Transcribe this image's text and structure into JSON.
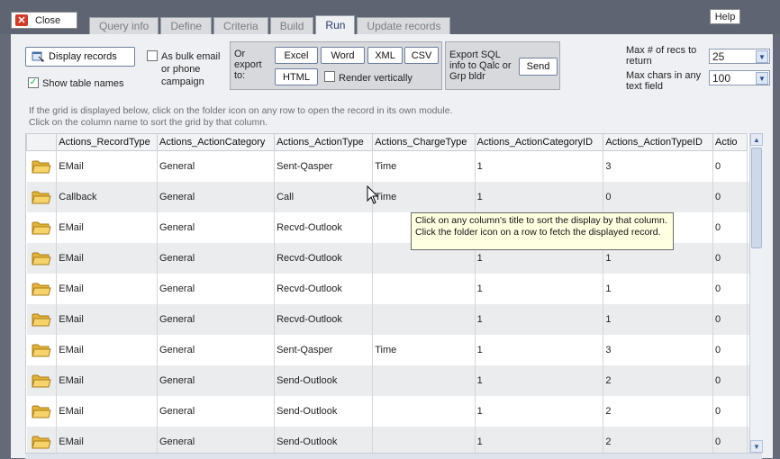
{
  "toolbar": {
    "close_label": "Close",
    "help_label": "Help"
  },
  "tabs": [
    {
      "label": "Query info",
      "active": false
    },
    {
      "label": "Define",
      "active": false
    },
    {
      "label": "Criteria",
      "active": false
    },
    {
      "label": "Build",
      "active": false
    },
    {
      "label": "Run",
      "active": true
    },
    {
      "label": "Update records",
      "active": false
    }
  ],
  "controls": {
    "display_records_label": "Display records",
    "show_table_names_label": "Show table names",
    "show_table_names_checked": true,
    "bulk_label": "As bulk email or phone campaign",
    "bulk_checked": false,
    "export_label": "Or export to:",
    "export_buttons": [
      "Excel",
      "Word",
      "XML",
      "CSV",
      "HTML"
    ],
    "render_vertically_label": "Render vertically",
    "render_vertically_checked": false,
    "export_sql_label": "Export SQL info to Qalc or Grp bldr",
    "send_label": "Send",
    "max_recs_label": "Max # of recs to return",
    "max_recs_value": "25",
    "max_chars_label": "Max chars in any text field",
    "max_chars_value": "100"
  },
  "hint": "If the grid is displayed below, click on the folder icon on any row to open the record in its own module. Click on the column name to sort the grid by that column.",
  "grid": {
    "columns": [
      "Actions_RecordType",
      "Actions_ActionCategory",
      "Actions_ActionType",
      "Actions_ChargeType",
      "Actions_ActionCategoryID",
      "Actions_ActionTypeID",
      "Actio"
    ],
    "rows": [
      [
        "EMail",
        "General",
        "Sent-Qasper",
        "Time",
        "1",
        "3",
        "0"
      ],
      [
        "Callback",
        "General",
        "Call",
        "Time",
        "1",
        "0",
        "0"
      ],
      [
        "EMail",
        "General",
        "Recvd-Outlook",
        "",
        "",
        "",
        "0"
      ],
      [
        "EMail",
        "General",
        "Recvd-Outlook",
        "",
        "1",
        "1",
        "0"
      ],
      [
        "EMail",
        "General",
        "Recvd-Outlook",
        "",
        "1",
        "1",
        "0"
      ],
      [
        "EMail",
        "General",
        "Recvd-Outlook",
        "",
        "1",
        "1",
        "0"
      ],
      [
        "EMail",
        "General",
        "Sent-Qasper",
        "Time",
        "1",
        "3",
        "0"
      ],
      [
        "EMail",
        "General",
        "Send-Outlook",
        "",
        "1",
        "2",
        "0"
      ],
      [
        "EMail",
        "General",
        "Send-Outlook",
        "",
        "1",
        "2",
        "0"
      ],
      [
        "EMail",
        "General",
        "Send-Outlook",
        "",
        "1",
        "2",
        "0"
      ]
    ]
  },
  "tooltip": "Click on any column's title to sort the display by that column. Click the folder icon on a row to fetch the displayed record."
}
